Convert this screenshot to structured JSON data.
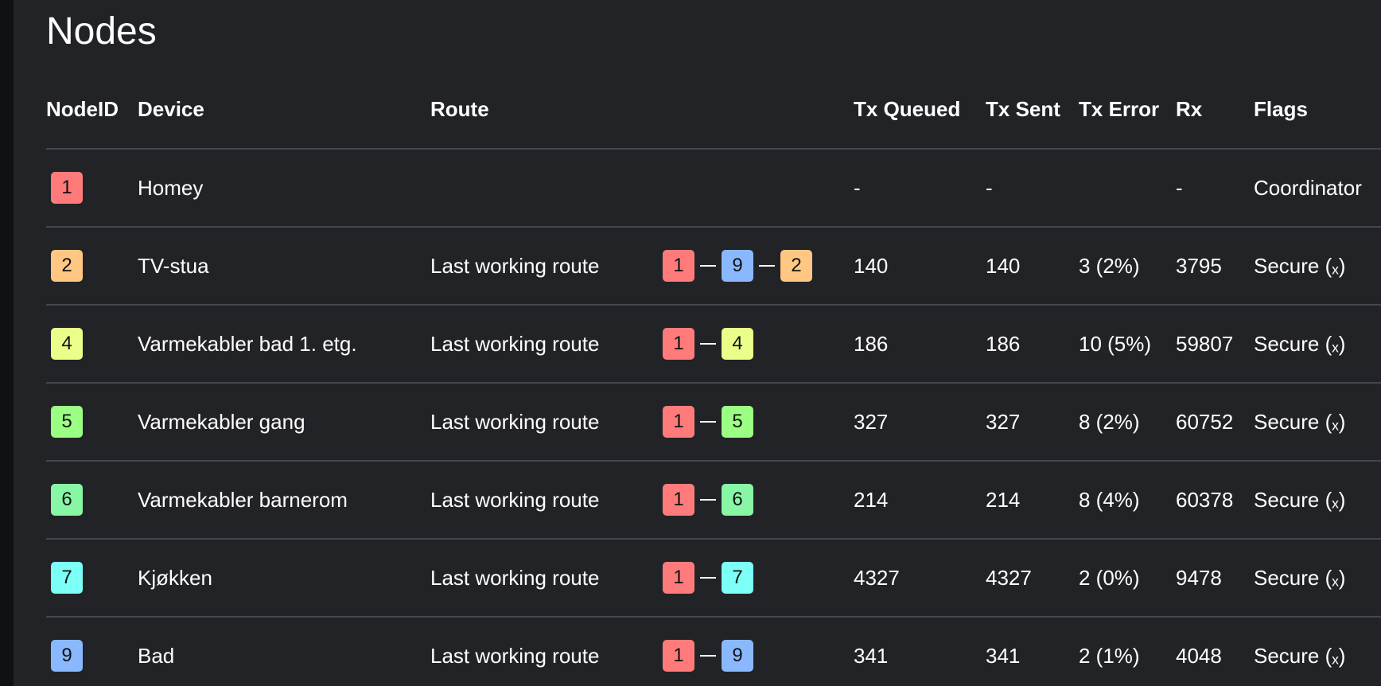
{
  "page": {
    "title": "Nodes"
  },
  "columns": {
    "node_id": "NodeID",
    "device": "Device",
    "route": "Route",
    "tx_queued": "Tx Queued",
    "tx_sent": "Tx Sent",
    "tx_error": "Tx Error",
    "rx": "Rx",
    "flags": "Flags"
  },
  "node_colors": {
    "1": "#ff7b7b",
    "2": "#ffc782",
    "4": "#eaff8a",
    "5": "#9aff82",
    "6": "#87f7a6",
    "7": "#7cfff7",
    "9": "#8ab8ff"
  },
  "nodes": [
    {
      "id": "1",
      "device": "Homey",
      "route_label": "",
      "route": [],
      "tx_queued": "-",
      "tx_sent": "-",
      "tx_error": "",
      "rx": "-",
      "flags": "Coordinator"
    },
    {
      "id": "2",
      "device": "TV-stua",
      "route_label": "Last working route",
      "route": [
        "1",
        "9",
        "2"
      ],
      "tx_queued": "140",
      "tx_sent": "140",
      "tx_error": "3 (2%)",
      "rx": "3795",
      "flags": "Secure (ₓ)"
    },
    {
      "id": "4",
      "device": "Varmekabler bad 1. etg.",
      "route_label": "Last working route",
      "route": [
        "1",
        "4"
      ],
      "tx_queued": "186",
      "tx_sent": "186",
      "tx_error": "10 (5%)",
      "rx": "59807",
      "flags": "Secure (ₓ)"
    },
    {
      "id": "5",
      "device": "Varmekabler gang",
      "route_label": "Last working route",
      "route": [
        "1",
        "5"
      ],
      "tx_queued": "327",
      "tx_sent": "327",
      "tx_error": "8 (2%)",
      "rx": "60752",
      "flags": "Secure (ₓ)"
    },
    {
      "id": "6",
      "device": "Varmekabler barnerom",
      "route_label": "Last working route",
      "route": [
        "1",
        "6"
      ],
      "tx_queued": "214",
      "tx_sent": "214",
      "tx_error": "8 (4%)",
      "rx": "60378",
      "flags": "Secure (ₓ)"
    },
    {
      "id": "7",
      "device": "Kjøkken",
      "route_label": "Last working route",
      "route": [
        "1",
        "7"
      ],
      "tx_queued": "4327",
      "tx_sent": "4327",
      "tx_error": "2 (0%)",
      "rx": "9478",
      "flags": "Secure (ₓ)"
    },
    {
      "id": "9",
      "device": "Bad",
      "route_label": "Last working route",
      "route": [
        "1",
        "9"
      ],
      "tx_queued": "341",
      "tx_sent": "341",
      "tx_error": "2 (1%)",
      "rx": "4048",
      "flags": "Secure (ₓ)"
    }
  ]
}
